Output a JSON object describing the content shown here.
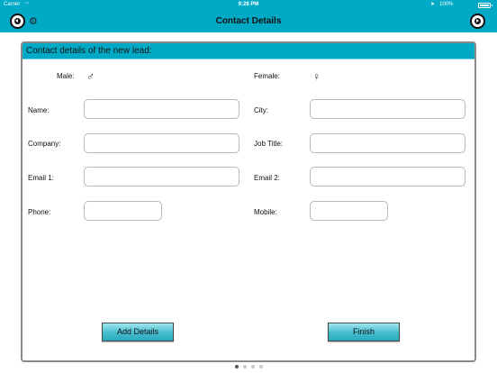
{
  "status_bar": {
    "carrier": "Carrier",
    "wifi_icon": "◠",
    "time": "9:28 PM",
    "location_icon": "➤",
    "battery": "100%"
  },
  "nav": {
    "title": "Contact Details",
    "gear_icon": "⚙"
  },
  "form": {
    "header": "Contact details of the new lead:",
    "male_label": "Male:",
    "male_icon": "♂",
    "female_label": "Female:",
    "female_icon": "♀",
    "fields": {
      "name": {
        "label": "Name:",
        "value": ""
      },
      "city": {
        "label": "City:",
        "value": ""
      },
      "company": {
        "label": "Company:",
        "value": ""
      },
      "job_title": {
        "label": "Job Title:",
        "value": ""
      },
      "email1": {
        "label": "Email 1:",
        "value": ""
      },
      "email2": {
        "label": "Email 2:",
        "value": ""
      },
      "phone": {
        "label": "Phone:",
        "value": ""
      },
      "mobile": {
        "label": "Mobile:",
        "value": ""
      }
    },
    "add_details_label": "Add Details",
    "finish_label": "Finish"
  },
  "pager": {
    "pages": 4,
    "active_page": 1
  },
  "colors": {
    "accent": "#00a9c6",
    "button_gradient_top": "#9fe6f0",
    "button_gradient_bottom": "#2aa9bd"
  }
}
